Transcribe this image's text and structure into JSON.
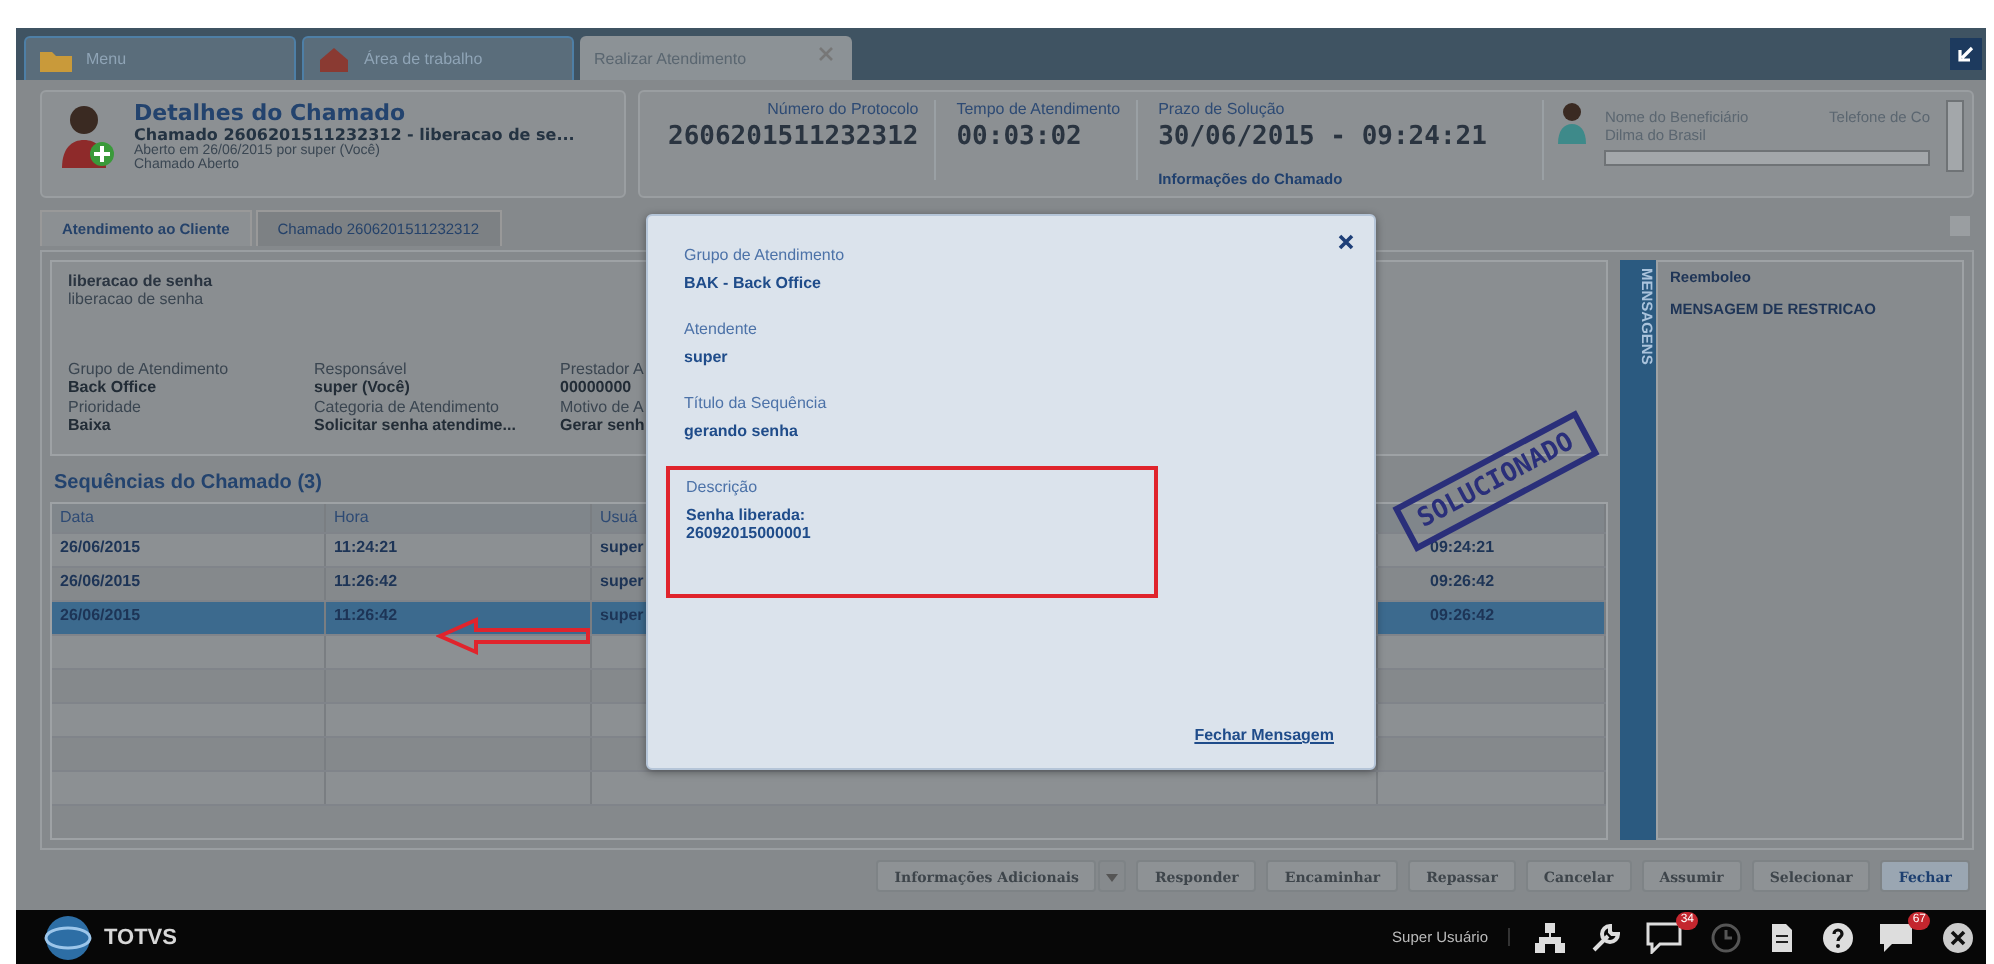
{
  "tabs": [
    {
      "label": "Menu",
      "kind": "folder",
      "selected": false
    },
    {
      "label": "Área de trabalho",
      "kind": "house",
      "selected": false
    },
    {
      "label": "Realizar Atendimento",
      "kind": "closable",
      "selected": true
    }
  ],
  "header": {
    "title": "Detalhes do Chamado",
    "subtitle": "Chamado 2606201511232312 - liberacao de se...",
    "opened": "Aberto em 26/06/2015 por super (Você)",
    "status": "Chamado Aberto"
  },
  "stats": [
    {
      "label": "Número do Protocolo",
      "value": "2606201511232312"
    },
    {
      "label": "Tempo de Atendimento",
      "value": "00:03:02"
    },
    {
      "label": "Prazo de Solução",
      "value": "30/06/2015 - 09:24:21"
    }
  ],
  "info_link": "Informações do Chamado",
  "beneficiary": {
    "name_label": "Nome do Beneficiário",
    "name": "Dilma do Brasil",
    "phone_label": "Telefone de Co"
  },
  "subtabs": [
    {
      "label": "Atendimento ao Cliente",
      "selected": true
    },
    {
      "label": "Chamado 2606201511232312",
      "selected": false
    }
  ],
  "details": {
    "title": "liberacao de senha",
    "text": "liberacao de senha",
    "fields": [
      {
        "label": "Grupo de Atendimento",
        "value": "Back Office"
      },
      {
        "label": "Responsável",
        "value": "super (Você)"
      },
      {
        "label": "Prestador A",
        "value": "00000000"
      },
      {
        "label": "Prioridade",
        "value": "Baixa"
      },
      {
        "label": "Categoria de Atendimento",
        "value": "Solicitar senha atendime..."
      },
      {
        "label": "Motivo de A",
        "value": "Gerar senh"
      }
    ]
  },
  "messages": {
    "tab_label": "MENSAGENS",
    "title": "Reemboleo",
    "text": "MENSAGEM DE RESTRICAO"
  },
  "sequences": {
    "title": "Sequências do Chamado (3)",
    "columns": [
      "Data",
      "Hora",
      "Usuá"
    ],
    "rows": [
      {
        "date": "26/06/2015",
        "time": "11:24:21",
        "user": "super",
        "deadline": "09:24:21",
        "selected": false
      },
      {
        "date": "26/06/2015",
        "time": "11:26:42",
        "user": "super",
        "deadline": "09:26:42",
        "selected": false
      },
      {
        "date": "26/06/2015",
        "time": "11:26:42",
        "user": "super",
        "deadline": "09:26:42",
        "selected": true
      }
    ]
  },
  "stamp": "SOLUCIONADO",
  "modal": {
    "fields": [
      {
        "label": "Grupo de Atendimento",
        "value": "BAK - Back Office",
        "highlighted": false
      },
      {
        "label": "Atendente",
        "value": "super",
        "highlighted": false
      },
      {
        "label": "Título da Sequência",
        "value": "gerando senha",
        "highlighted": false
      },
      {
        "label": "Descrição",
        "value": "Senha liberada:\n26092015000001",
        "highlighted": true
      }
    ],
    "close_link": "Fechar Mensagem"
  },
  "buttons": [
    {
      "label": "Informações Adicionais",
      "kind": "dropdown",
      "disabled": true
    },
    {
      "label": "Responder",
      "kind": "plain",
      "disabled": true
    },
    {
      "label": "Encaminhar",
      "kind": "plain",
      "disabled": true
    },
    {
      "label": "Repassar",
      "kind": "plain",
      "disabled": true
    },
    {
      "label": "Cancelar",
      "kind": "plain",
      "disabled": true
    },
    {
      "label": "Assumir",
      "kind": "plain",
      "disabled": true
    },
    {
      "label": "Selecionar",
      "kind": "plain",
      "disabled": true
    },
    {
      "label": "Fechar",
      "kind": "plain",
      "disabled": false
    }
  ],
  "taskbar": {
    "brand": "TOTVS",
    "user": "Super Usuário",
    "chat_badge": "34",
    "messages_badge": "67"
  }
}
